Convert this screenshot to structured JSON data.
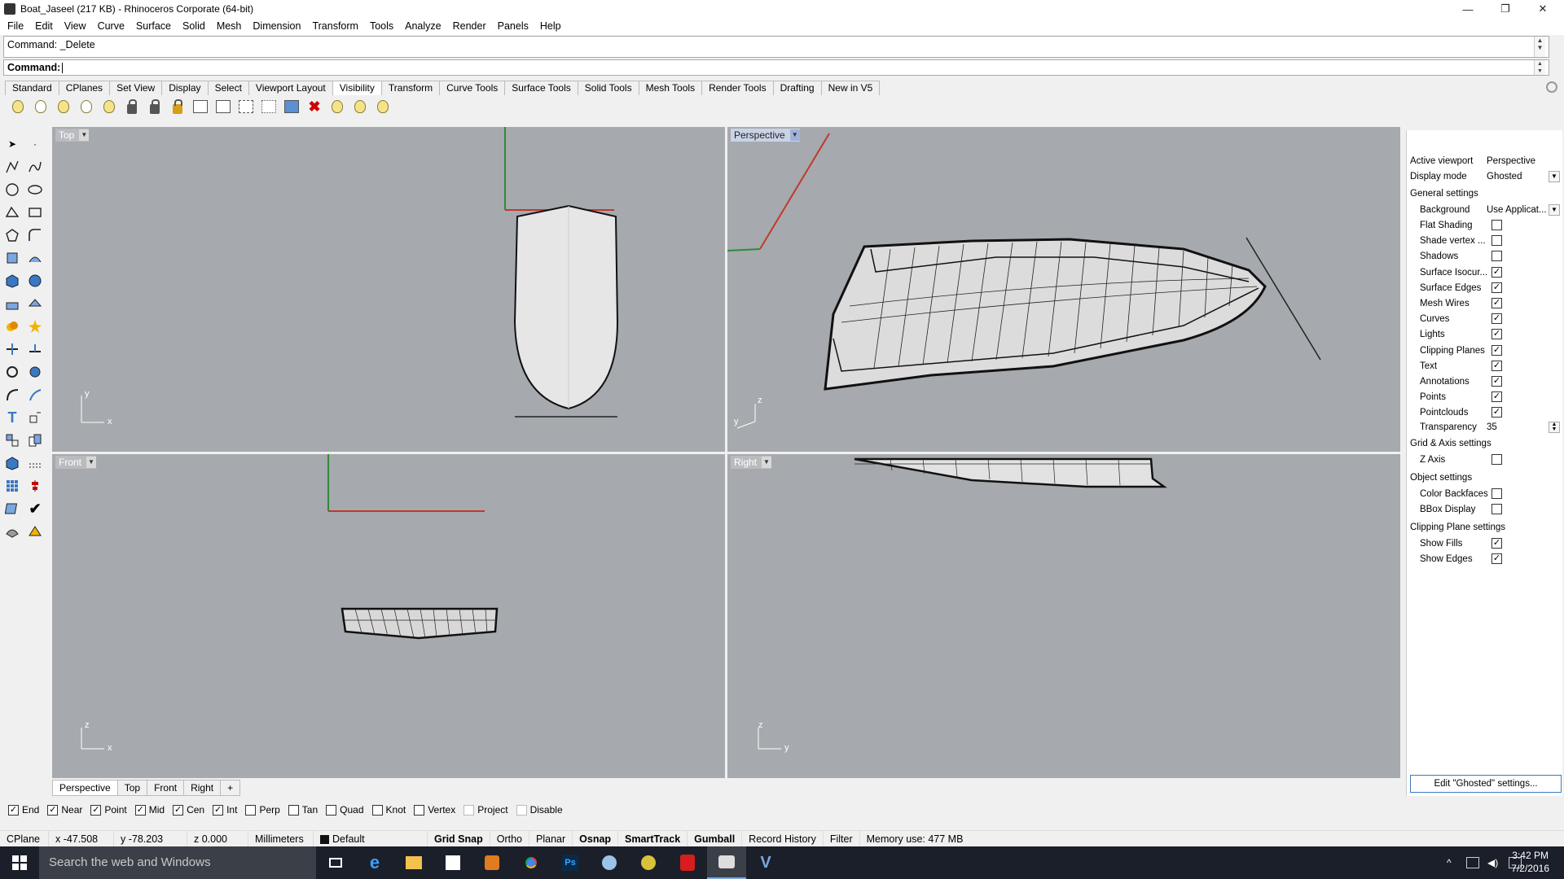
{
  "window": {
    "title": "Boat_Jaseel (217 KB) - Rhinoceros Corporate (64-bit)"
  },
  "menu": [
    "File",
    "Edit",
    "View",
    "Curve",
    "Surface",
    "Solid",
    "Mesh",
    "Dimension",
    "Transform",
    "Tools",
    "Analyze",
    "Render",
    "Panels",
    "Help"
  ],
  "command": {
    "history": "Command: _Delete",
    "prompt": "Command:"
  },
  "toolbar_tabs": [
    "Standard",
    "CPlanes",
    "Set View",
    "Display",
    "Select",
    "Viewport Layout",
    "Visibility",
    "Transform",
    "Curve Tools",
    "Surface Tools",
    "Solid Tools",
    "Mesh Tools",
    "Render Tools",
    "Drafting",
    "New in V5"
  ],
  "active_toolbar_tab": "Visibility",
  "viewports": {
    "top": {
      "name": "Top",
      "axis_a": "y",
      "axis_b": "x"
    },
    "perspective": {
      "name": "Perspective",
      "axis_a": "z",
      "axis_b": "y"
    },
    "front": {
      "name": "Front",
      "axis_a": "z",
      "axis_b": "x"
    },
    "right": {
      "name": "Right",
      "axis_a": "z",
      "axis_b": "y"
    }
  },
  "viewport_tabs": [
    "Perspective",
    "Top",
    "Front",
    "Right"
  ],
  "viewport_tabs_add": "+",
  "osnap": [
    {
      "label": "End",
      "checked": true
    },
    {
      "label": "Near",
      "checked": true
    },
    {
      "label": "Point",
      "checked": true
    },
    {
      "label": "Mid",
      "checked": true
    },
    {
      "label": "Cen",
      "checked": true
    },
    {
      "label": "Int",
      "checked": true
    },
    {
      "label": "Perp",
      "checked": false
    },
    {
      "label": "Tan",
      "checked": false
    },
    {
      "label": "Quad",
      "checked": false
    },
    {
      "label": "Knot",
      "checked": false
    },
    {
      "label": "Vertex",
      "checked": false
    },
    {
      "label": "Project",
      "checked": false
    },
    {
      "label": "Disable",
      "checked": false
    }
  ],
  "status": {
    "cplane": "CPlane",
    "x": "x -47.508",
    "y": "y -78.203",
    "z": "z 0.000",
    "units": "Millimeters",
    "layer": "Default",
    "grid_snap": "Grid Snap",
    "ortho": "Ortho",
    "planar": "Planar",
    "osnap": "Osnap",
    "smarttrack": "SmartTrack",
    "gumball": "Gumball",
    "record_history": "Record History",
    "filter": "Filter",
    "memory": "Memory use: 477 MB"
  },
  "panel": {
    "active_viewport_label": "Active viewport",
    "active_viewport": "Perspective",
    "display_mode_label": "Display mode",
    "display_mode": "Ghosted",
    "general_settings": "General settings",
    "background_label": "Background",
    "background": "Use Applicat...",
    "general": [
      {
        "label": "Flat Shading",
        "checked": false
      },
      {
        "label": "Shade vertex ...",
        "checked": false
      },
      {
        "label": "Shadows",
        "checked": false
      },
      {
        "label": "Surface Isocur...",
        "checked": true
      },
      {
        "label": "Surface Edges",
        "checked": true
      },
      {
        "label": "Mesh Wires",
        "checked": true
      },
      {
        "label": "Curves",
        "checked": true
      },
      {
        "label": "Lights",
        "checked": true
      },
      {
        "label": "Clipping Planes",
        "checked": true
      },
      {
        "label": "Text",
        "checked": true
      },
      {
        "label": "Annotations",
        "checked": true
      },
      {
        "label": "Points",
        "checked": true
      },
      {
        "label": "Pointclouds",
        "checked": true
      }
    ],
    "transparency_label": "Transparency",
    "transparency": "35",
    "grid_axis_settings": "Grid & Axis settings",
    "z_axis_label": "Z Axis",
    "z_axis": false,
    "object_settings": "Object settings",
    "color_backfaces_label": "Color Backfaces",
    "color_backfaces": false,
    "bbox_display_label": "BBox Display",
    "bbox_display": false,
    "clipping_plane_settings": "Clipping Plane settings",
    "show_fills_label": "Show Fills",
    "show_fills": true,
    "show_edges_label": "Show Edges",
    "show_edges": true,
    "edit_button": "Edit \"Ghosted\" settings..."
  },
  "taskbar": {
    "search_placeholder": "Search the web and Windows",
    "time": "3:42 PM",
    "date": "7/2/2016"
  },
  "colors": {
    "viewport_bg": "#a6a9ae",
    "x_axis": "#c0392b",
    "y_axis": "#2e8b3a",
    "accent": "#3b78c2"
  }
}
